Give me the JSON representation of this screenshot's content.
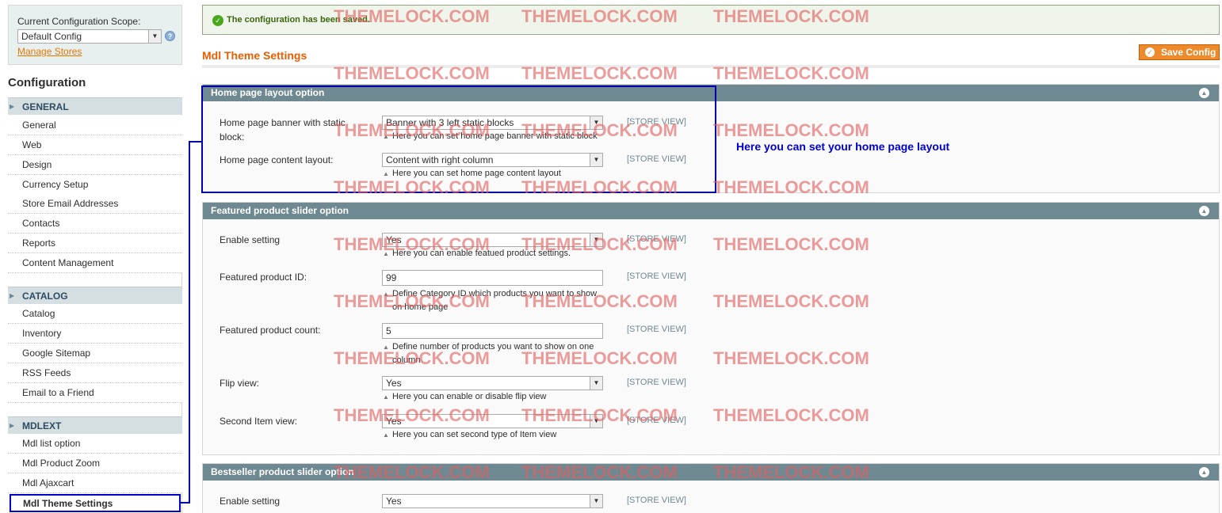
{
  "scope": {
    "label": "Current Configuration Scope:",
    "selected": "Default Config",
    "manage_link": "Manage Stores"
  },
  "sidebar": {
    "title": "Configuration",
    "sections": [
      {
        "name": "GENERAL",
        "items": [
          "General",
          "Web",
          "Design",
          "Currency Setup",
          "Store Email Addresses",
          "Contacts",
          "Reports",
          "Content Management"
        ]
      },
      {
        "name": "CATALOG",
        "items": [
          "Catalog",
          "Inventory",
          "Google Sitemap",
          "RSS Feeds",
          "Email to a Friend"
        ]
      },
      {
        "name": "MDLEXT",
        "items": [
          "Mdl list option",
          "Mdl Product Zoom",
          "Mdl Ajaxcart",
          "Mdl Theme Settings"
        ]
      }
    ],
    "active_item": "Mdl Theme Settings"
  },
  "message": {
    "text": "The configuration has been saved."
  },
  "page": {
    "title": "Mdl Theme Settings",
    "save_label": "Save Config"
  },
  "fieldsets": {
    "homepage": {
      "title": "Home page layout option",
      "rows": [
        {
          "label": "Home page banner with static block:",
          "value": "Banner with 3 left static blocks",
          "note": "Here you can set home page banner with static block",
          "scope": "[STORE VIEW]"
        },
        {
          "label": "Home page content layout:",
          "value": "Content with right column",
          "note": "Here you can set home page content layout",
          "scope": "[STORE VIEW]"
        }
      ]
    },
    "featured": {
      "title": "Featured product slider option",
      "rows": [
        {
          "label": "Enable setting",
          "value": "Yes",
          "note": "Here you can enable featued product settings.",
          "scope": "[STORE VIEW]"
        },
        {
          "label": "Featured product ID:",
          "value": "99",
          "note": "Define Category ID which products you want to show on home page",
          "scope": "[STORE VIEW]"
        },
        {
          "label": "Featured product count:",
          "value": "5",
          "note": "Define number of products you want to show on one column",
          "scope": "[STORE VIEW]"
        },
        {
          "label": "Flip view:",
          "value": "Yes",
          "note": "Here you can enable or disable flip view",
          "scope": "[STORE VIEW]"
        },
        {
          "label": "Second Item view:",
          "value": "Yes",
          "note": "Here you can set second type of Item view",
          "scope": "[STORE VIEW]"
        }
      ]
    },
    "bestseller": {
      "title": "Bestseller product slider option",
      "rows": [
        {
          "label": "Enable setting",
          "value": "Yes",
          "scope": "[STORE VIEW]"
        }
      ]
    }
  },
  "annotation": {
    "text": "Here you can set your home page layout"
  },
  "watermark": {
    "text": "THEMELOCK.COM"
  },
  "colors": {
    "accent": "#eb5e00",
    "header_bar": "#6f8992",
    "annotation": "#0000cc"
  }
}
